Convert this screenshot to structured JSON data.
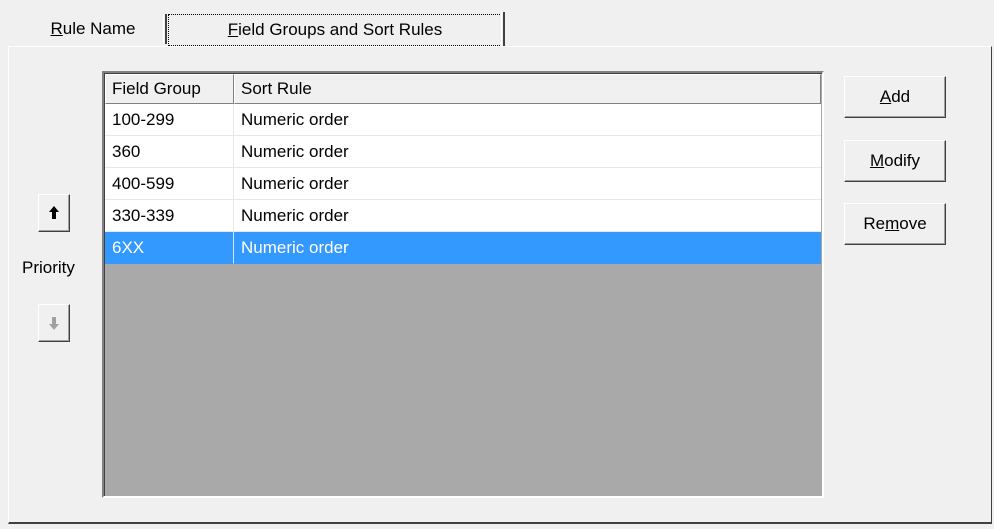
{
  "tabs": [
    {
      "label_pre": "",
      "label_key": "R",
      "label_post": "ule Name"
    },
    {
      "label_pre": "",
      "label_key": "F",
      "label_post": "ield Groups and Sort Rules"
    }
  ],
  "priority": {
    "label": "Priority",
    "up_icon": "arrow-up-icon",
    "down_icon": "arrow-down-icon"
  },
  "list": {
    "columns": [
      "Field Group",
      "Sort Rule"
    ],
    "rows": [
      {
        "field_group": "100-299",
        "sort_rule": "Numeric order"
      },
      {
        "field_group": "360",
        "sort_rule": "Numeric order"
      },
      {
        "field_group": "400-599",
        "sort_rule": "Numeric order"
      },
      {
        "field_group": "330-339",
        "sort_rule": "Numeric order"
      },
      {
        "field_group": "6XX",
        "sort_rule": "Numeric order",
        "selected": true
      }
    ]
  },
  "buttons": {
    "add": {
      "pre": "",
      "key": "A",
      "post": "dd"
    },
    "modify": {
      "pre": "",
      "key": "M",
      "post": "odify"
    },
    "remove": {
      "pre": "Re",
      "key": "m",
      "post": "ove"
    }
  },
  "colors": {
    "selection": "#3399ff",
    "list_background": "#a9a9a9",
    "window": "#f0f0f0"
  }
}
